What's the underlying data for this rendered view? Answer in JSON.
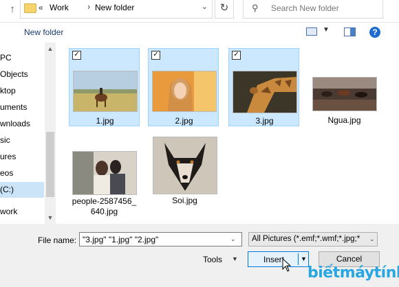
{
  "address": {
    "crumbs": [
      "Work",
      "New folder"
    ],
    "search_placeholder": "Search New folder"
  },
  "toolbar": {
    "new_folder": "New folder"
  },
  "nav": {
    "items": [
      "PC",
      "Objects",
      "ktop",
      "uments",
      "wnloads",
      "sic",
      "ures",
      "eos",
      "(C:)",
      "work"
    ],
    "selected_index": 8
  },
  "files": [
    {
      "name": "1.jpg",
      "selected": true
    },
    {
      "name": "2.jpg",
      "selected": true
    },
    {
      "name": "3.jpg",
      "selected": true
    },
    {
      "name": "Ngua.jpg",
      "selected": false
    },
    {
      "name_line1": "people-2587456_",
      "name_line2": "640.jpg",
      "selected": false
    },
    {
      "name": "Soi.jpg",
      "selected": false
    }
  ],
  "bottom": {
    "file_name_label": "File name:",
    "file_name_value": "\"3.jpg\" \"1.jpg\" \"2.jpg\"",
    "filter": "All Pictures (*.emf;*.wmf;*.jpg;*",
    "tools": "Tools",
    "insert": "Insert",
    "cancel": "Cancel"
  },
  "watermark": "biếtmáytính",
  "colors": {
    "selection": "#cce8ff",
    "accent": "#0078d7",
    "watermark": "#2aa7e0"
  }
}
